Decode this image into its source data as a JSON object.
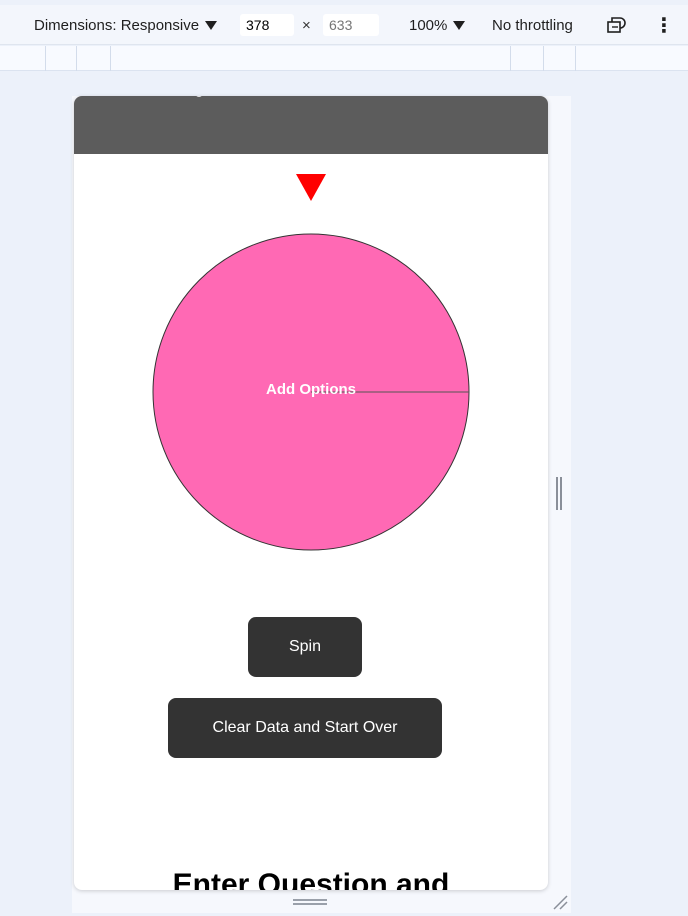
{
  "devtools": {
    "dimensions_label": "Dimensions: Responsive",
    "width_value": "378",
    "times_symbol": "×",
    "height_placeholder": "633",
    "zoom_label": "100%",
    "throttling_label": "No throttling",
    "more_glyph": "⋮"
  },
  "app": {
    "wheel_label": "Add Options",
    "spin_label": "Spin",
    "clear_label": "Clear Data and Start Over",
    "section_heading": "Enter Question and"
  },
  "colors": {
    "header": "#5c5c5c",
    "pointer": "#ff0000",
    "wheel": "#ff69b4",
    "button": "#333333"
  }
}
